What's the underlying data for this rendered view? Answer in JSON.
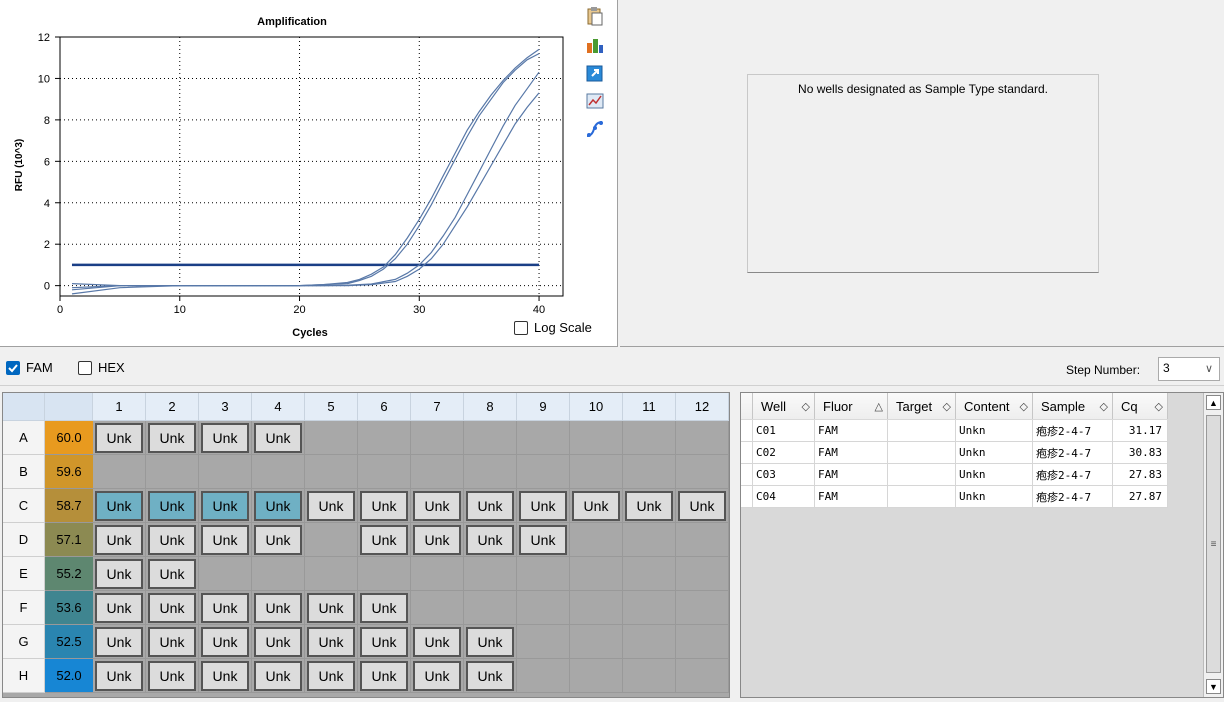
{
  "chart": {
    "title": "Amplification",
    "xlabel": "Cycles",
    "ylabel": "RFU (10^3)",
    "log_scale_label": "Log Scale",
    "log_scale_checked": false,
    "icons": [
      "copy-icon",
      "export-data-icon",
      "export-image-icon",
      "chart-settings-icon",
      "curve-icon"
    ]
  },
  "chart_data": {
    "type": "line",
    "title": "Amplification",
    "xlabel": "Cycles",
    "ylabel": "RFU (10^3)",
    "xlim": [
      0,
      42
    ],
    "ylim": [
      -0.5,
      12
    ],
    "xticks": [
      0,
      10,
      20,
      30,
      40
    ],
    "yticks": [
      0,
      2,
      4,
      6,
      8,
      10,
      12
    ],
    "grid": true,
    "threshold": 1.0,
    "series": [
      {
        "x": [
          1,
          5,
          10,
          15,
          20,
          22,
          24,
          25,
          26,
          27,
          28,
          29,
          30,
          31,
          32,
          33,
          34,
          35,
          36,
          37,
          38,
          39,
          40
        ],
        "y": [
          -0.1,
          0,
          0,
          0,
          0,
          0.05,
          0.15,
          0.3,
          0.55,
          0.9,
          1.5,
          2.3,
          3.2,
          4.2,
          5.3,
          6.4,
          7.5,
          8.4,
          9.2,
          9.9,
          10.5,
          11.0,
          11.4
        ]
      },
      {
        "x": [
          1,
          5,
          10,
          15,
          20,
          22,
          24,
          25,
          26,
          27,
          28,
          29,
          30,
          31,
          32,
          33,
          34,
          35,
          36,
          37,
          38,
          39,
          40
        ],
        "y": [
          0.1,
          0,
          0,
          0,
          0,
          0.05,
          0.1,
          0.25,
          0.45,
          0.8,
          1.3,
          2.0,
          2.9,
          3.9,
          5.0,
          6.1,
          7.2,
          8.2,
          9.0,
          9.8,
          10.4,
          10.9,
          11.2
        ]
      },
      {
        "x": [
          1,
          5,
          10,
          15,
          20,
          22,
          24,
          26,
          28,
          29,
          30,
          31,
          32,
          33,
          34,
          35,
          36,
          37,
          38,
          39,
          40
        ],
        "y": [
          -0.2,
          0,
          0,
          0,
          0,
          0,
          0.02,
          0.08,
          0.3,
          0.6,
          1.0,
          1.6,
          2.4,
          3.3,
          4.4,
          5.5,
          6.6,
          7.7,
          8.7,
          9.5,
          10.3
        ]
      },
      {
        "x": [
          1,
          5,
          10,
          15,
          20,
          22,
          24,
          26,
          28,
          29,
          30,
          31,
          32,
          33,
          34,
          35,
          36,
          37,
          38,
          39,
          40
        ],
        "y": [
          -0.4,
          -0.1,
          0,
          0,
          0,
          0,
          0,
          0.05,
          0.2,
          0.45,
          0.8,
          1.3,
          2.0,
          2.9,
          3.8,
          4.8,
          5.8,
          6.8,
          7.8,
          8.6,
          9.3
        ]
      }
    ]
  },
  "standard_curve": {
    "message": "No wells designated as Sample Type standard."
  },
  "fluor_bar": {
    "fam_label": "FAM",
    "fam_checked": true,
    "hex_label": "HEX",
    "hex_checked": false,
    "step_label": "Step Number:",
    "step_value": "3"
  },
  "plate": {
    "columns": [
      "1",
      "2",
      "3",
      "4",
      "5",
      "6",
      "7",
      "8",
      "9",
      "10",
      "11",
      "12"
    ],
    "rows": [
      {
        "label": "A",
        "temp": "60.0",
        "color": "#e89a1f",
        "wells": [
          "Unk",
          "Unk",
          "Unk",
          "Unk",
          "",
          "",
          "",
          "",
          "",
          "",
          "",
          ""
        ],
        "selected": []
      },
      {
        "label": "B",
        "temp": "59.6",
        "color": "#d0962a",
        "wells": [
          "",
          "",
          "",
          "",
          "",
          "",
          "",
          "",
          "",
          "",
          "",
          ""
        ],
        "selected": []
      },
      {
        "label": "C",
        "temp": "58.7",
        "color": "#b58f3a",
        "wells": [
          "Unk",
          "Unk",
          "Unk",
          "Unk",
          "Unk",
          "Unk",
          "Unk",
          "Unk",
          "Unk",
          "Unk",
          "Unk",
          "Unk"
        ],
        "selected": [
          0,
          1,
          2,
          3
        ]
      },
      {
        "label": "D",
        "temp": "57.1",
        "color": "#8c8a52",
        "wells": [
          "Unk",
          "Unk",
          "Unk",
          "Unk",
          "",
          "Unk",
          "Unk",
          "Unk",
          "Unk",
          "",
          "",
          ""
        ],
        "selected": []
      },
      {
        "label": "E",
        "temp": "55.2",
        "color": "#5e8770",
        "wells": [
          "Unk",
          "Unk",
          "",
          "",
          "",
          "",
          "",
          "",
          "",
          "",
          "",
          ""
        ],
        "selected": []
      },
      {
        "label": "F",
        "temp": "53.6",
        "color": "#3f8590",
        "wells": [
          "Unk",
          "Unk",
          "Unk",
          "Unk",
          "Unk",
          "Unk",
          "",
          "",
          "",
          "",
          "",
          ""
        ],
        "selected": []
      },
      {
        "label": "G",
        "temp": "52.5",
        "color": "#2a85b0",
        "wells": [
          "Unk",
          "Unk",
          "Unk",
          "Unk",
          "Unk",
          "Unk",
          "Unk",
          "Unk",
          "",
          "",
          "",
          ""
        ],
        "selected": []
      },
      {
        "label": "H",
        "temp": "52.0",
        "color": "#1786d4",
        "wells": [
          "Unk",
          "Unk",
          "Unk",
          "Unk",
          "Unk",
          "Unk",
          "Unk",
          "Unk",
          "",
          "",
          "",
          ""
        ],
        "selected": []
      }
    ]
  },
  "table": {
    "headers": [
      {
        "label": "Well",
        "sort": "◇"
      },
      {
        "label": "Fluor",
        "sort": "△"
      },
      {
        "label": "Target",
        "sort": "◇"
      },
      {
        "label": "Content",
        "sort": "◇"
      },
      {
        "label": "Sample",
        "sort": "◇"
      },
      {
        "label": "Cq",
        "sort": "◇"
      }
    ],
    "rows": [
      [
        "C01",
        "FAM",
        "",
        "Unkn",
        "疱疹2-4-7",
        "31.17"
      ],
      [
        "C02",
        "FAM",
        "",
        "Unkn",
        "疱疹2-4-7",
        "30.83"
      ],
      [
        "C03",
        "FAM",
        "",
        "Unkn",
        "疱疹2-4-7",
        "27.83"
      ],
      [
        "C04",
        "FAM",
        "",
        "Unkn",
        "疱疹2-4-7",
        "27.87"
      ]
    ]
  }
}
